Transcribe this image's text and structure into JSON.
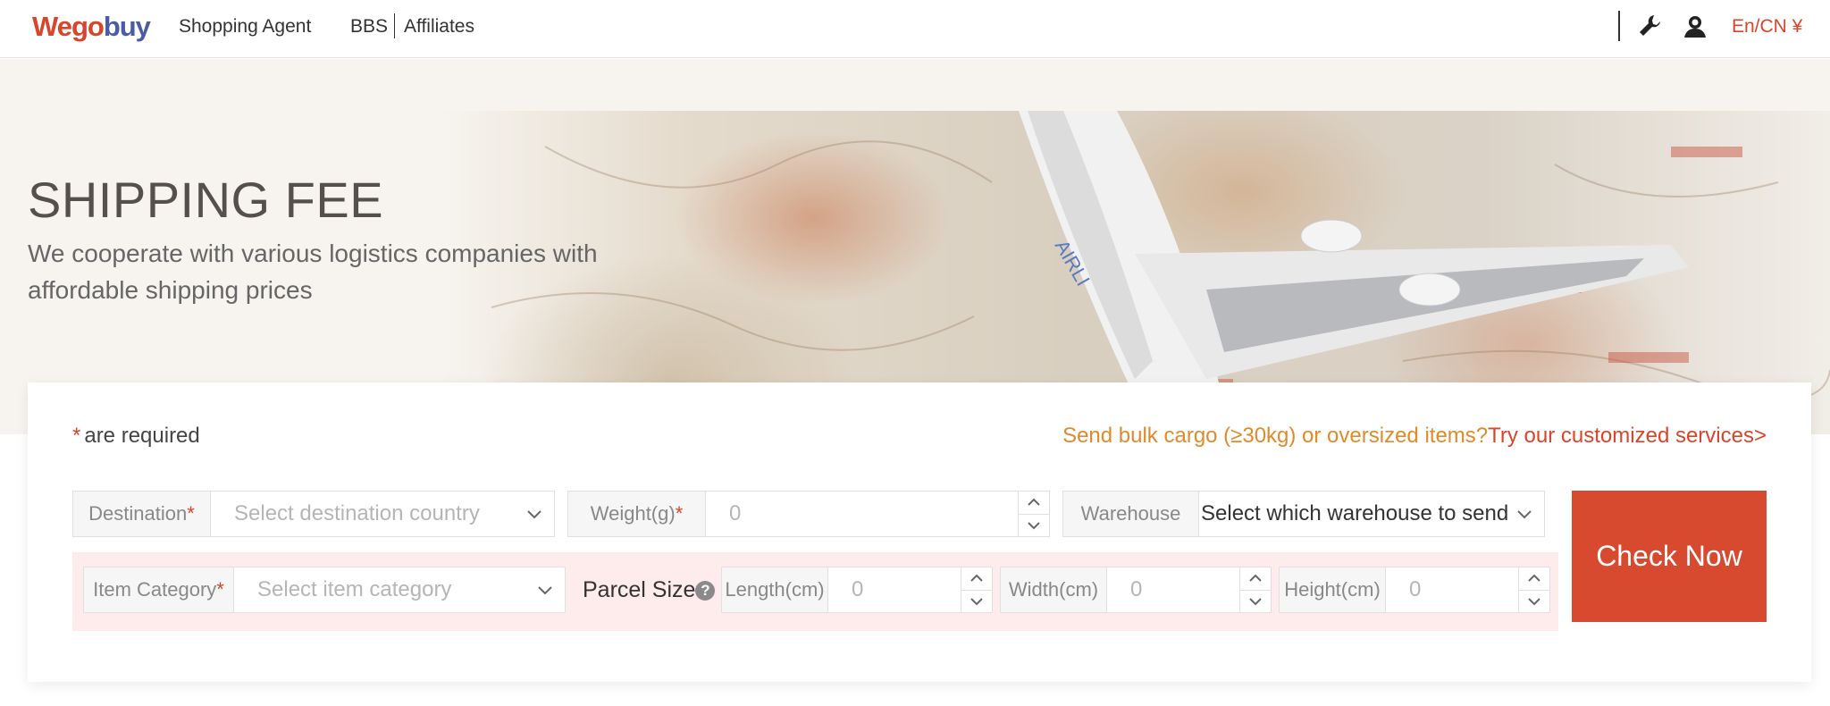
{
  "brand": {
    "logo_part1": "Wego",
    "logo_part2": "buy",
    "accent": "#d9452b",
    "logo_blue": "#4c5ba5"
  },
  "nav": {
    "shopping_agent": "Shopping Agent",
    "bbs": "BBS",
    "affiliates": "Affiliates",
    "icons": [
      "wrench-icon",
      "user-icon"
    ],
    "lang": "En/CN ¥"
  },
  "hero": {
    "title": "SHIPPING FEE",
    "subtitle": "We cooperate with various logistics companies with affordable shipping prices"
  },
  "form": {
    "required_star": "*",
    "required_text": "are required",
    "bulk_question": "Send bulk cargo (≥30kg) or oversized items?",
    "bulk_link": "Try our customized services>",
    "destination": {
      "label": "Destination",
      "star": "*",
      "placeholder": "Select destination country"
    },
    "weight": {
      "label": "Weight(g)",
      "star": "*",
      "value": "0"
    },
    "warehouse": {
      "label": "Warehouse",
      "placeholder": "Select which warehouse to send"
    },
    "item_category": {
      "label": "Item Category",
      "star": "*",
      "placeholder": "Select item category"
    },
    "parcel_size": {
      "label": "Parcel Size",
      "help": "?"
    },
    "length": {
      "label": "Length(cm)",
      "value": "0"
    },
    "width": {
      "label": "Width(cm)",
      "value": "0"
    },
    "height": {
      "label": "Height(cm)",
      "value": "0"
    },
    "check_button": "Check Now"
  }
}
